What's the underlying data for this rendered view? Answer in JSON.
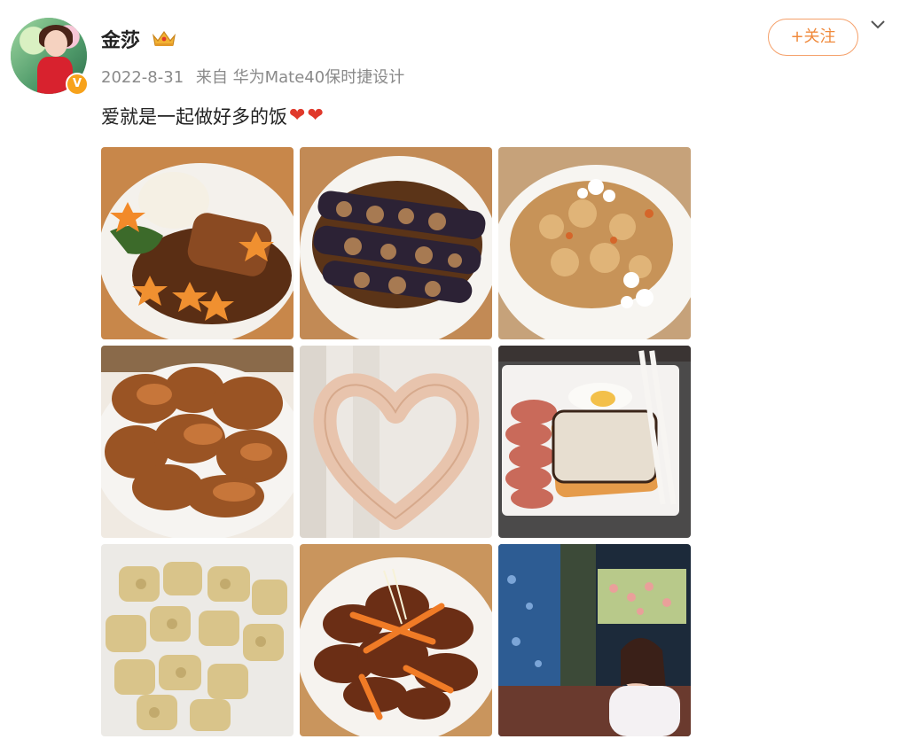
{
  "user": {
    "name": "金莎",
    "verified_badge": "V",
    "date": "2022-8-31",
    "source": "来自 华为Mate40保时捷设计"
  },
  "follow_button": {
    "label": "+关注"
  },
  "post": {
    "text": "爱就是一起做好多的饭",
    "hearts": [
      "❤",
      "❤"
    ]
  },
  "images": [
    {
      "name": "steak-with-rice-and-star-carrots",
      "watermark": ""
    },
    {
      "name": "stuffed-eggplant",
      "watermark": ""
    },
    {
      "name": "fried-rice",
      "watermark": ""
    },
    {
      "name": "fried-chicken",
      "watermark": ""
    },
    {
      "name": "heart-hands",
      "watermark": ""
    },
    {
      "name": "toast-and-egg-breakfast",
      "watermark": ""
    },
    {
      "name": "fried-tofu-cubes",
      "watermark": ""
    },
    {
      "name": "stir-fried-beef-with-carrots",
      "watermark": ""
    },
    {
      "name": "aquarium-selfie",
      "watermark": ""
    }
  ],
  "colors": {
    "accent_orange": "#f08a3c",
    "heart_red": "#e0392b",
    "verified_orange": "#f7a21b"
  }
}
